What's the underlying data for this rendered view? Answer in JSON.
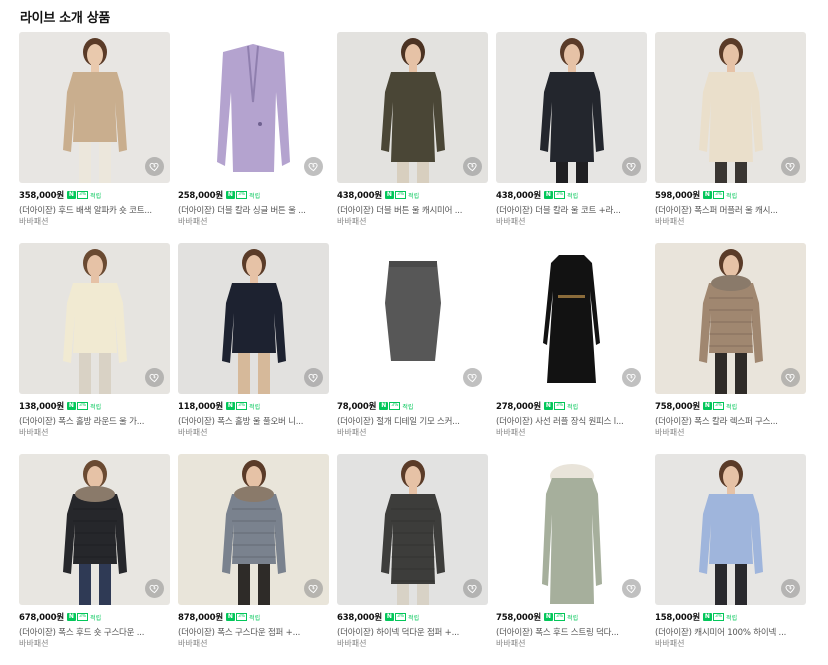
{
  "section_title": "라이브 소개 상품",
  "products": [
    {
      "price": "358,000원",
      "name": "(더아이잗) 후드 배색 알파카 숏 코트...",
      "seller": "바바패션",
      "bg": "#e8e6e3",
      "coat": "#c9ae8e",
      "skin": "#e9c9ad",
      "hair": "#5a3b28",
      "pants": "#ece7dc",
      "style": "short"
    },
    {
      "price": "258,000원",
      "name": "(더아이잗) 더블 칼라 싱글 버튼 울 ...",
      "seller": "바바패션",
      "bg": "#ffffff",
      "coat": "#b4a3cf",
      "skin": "#ffffff",
      "hair": "#ffffff",
      "pants": "#ffffff",
      "style": "flat"
    },
    {
      "price": "438,000원",
      "name": "(더아이잗) 더블 버튼 울 캐시미어 ...",
      "seller": "바바패션",
      "bg": "#e3e2df",
      "coat": "#4a4636",
      "skin": "#e6c2a6",
      "hair": "#4b3222",
      "pants": "#d8cfbf",
      "style": "long"
    },
    {
      "price": "438,000원",
      "name": "(더아이잗) 더블 칼라 울 코트 +라...",
      "seller": "바바패션",
      "bg": "#e6e5e3",
      "coat": "#23262d",
      "skin": "#e6c2a6",
      "hair": "#5a3b28",
      "pants": "#1f1f22",
      "style": "long"
    },
    {
      "price": "598,000원",
      "name": "(더아이잗) 폭스퍼 머플러 울 캐시...",
      "seller": "바바패션",
      "bg": "#e7e5e1",
      "coat": "#eadfcb",
      "skin": "#e6c2a6",
      "hair": "#5a3b28",
      "pants": "#3a3632",
      "style": "long"
    },
    {
      "price": "138,000원",
      "name": "(더아이잗) 폭스 홀방 라운드 울 가...",
      "seller": "바바패션",
      "bg": "#e6e4e0",
      "coat": "#f1ead2",
      "skin": "#e6c2a6",
      "hair": "#6a4a32",
      "pants": "#d9d2c5",
      "style": "short"
    },
    {
      "price": "118,000원",
      "name": "(더아이잗) 폭스 홀방 울 풀오버 니...",
      "seller": "바바패션",
      "bg": "#e2e1df",
      "coat": "#1d2230",
      "skin": "#e6c2a6",
      "hair": "#5a3b28",
      "pants": "#d6b99a",
      "style": "short"
    },
    {
      "price": "78,000원",
      "name": "(더아이잗) 절개 디테일 기모 스커...",
      "seller": "바바패션",
      "bg": "#ffffff",
      "coat": "#575757",
      "skin": "#ffffff",
      "hair": "#ffffff",
      "pants": "#ffffff",
      "style": "skirt"
    },
    {
      "price": "278,000원",
      "name": "(더아이잗) 사선 러플 장식 원피스 l...",
      "seller": "바바패션",
      "bg": "#ffffff",
      "coat": "#121212",
      "skin": "#ffffff",
      "hair": "#ffffff",
      "pants": "#ffffff",
      "style": "dress"
    },
    {
      "price": "758,000원",
      "name": "(더아이잗) 폭스 칼라 렉스퍼 구스...",
      "seller": "바바패션",
      "bg": "#e9e4db",
      "coat": "#a08770",
      "skin": "#e6c2a6",
      "hair": "#5a3b28",
      "pants": "#2f2b28",
      "style": "puffer"
    },
    {
      "price": "678,000원",
      "name": "(더아이잗) 폭스 후드 숏 구스다운 ...",
      "seller": "바바패션",
      "bg": "#e8e6e1",
      "coat": "#26272b",
      "skin": "#e6c2a6",
      "hair": "#6a4a32",
      "pants": "#2f3a55",
      "style": "puffer"
    },
    {
      "price": "878,000원",
      "name": "(더아이잗) 폭스 구스다운 점퍼 +...",
      "seller": "바바패션",
      "bg": "#e9e5da",
      "coat": "#7a828e",
      "skin": "#e6c2a6",
      "hair": "#5a3b28",
      "pants": "#2e2b28",
      "style": "puffer"
    },
    {
      "price": "638,000원",
      "name": "(더아이잗) 하이넥 덕다운 점퍼 +...",
      "seller": "바바패션",
      "bg": "#e2e2e1",
      "coat": "#3d3d3b",
      "skin": "#e6c2a6",
      "hair": "#5a3b28",
      "pants": "#d8d2c6",
      "style": "longpuffer"
    },
    {
      "price": "758,000원",
      "name": "(더아이잗) 폭스 후드 스트링 덕다...",
      "seller": "바바패션",
      "bg": "#ffffff",
      "coat": "#a6af9c",
      "skin": "#ffffff",
      "hair": "#ffffff",
      "pants": "#ffffff",
      "style": "parka"
    },
    {
      "price": "158,000원",
      "name": "(더아이잗) 캐시미어 100% 하이넥 ...",
      "seller": "바바패션",
      "bg": "#e6e5e3",
      "coat": "#9fb5dc",
      "skin": "#e6c2a6",
      "hair": "#5a3b28",
      "pants": "#2a2a2e",
      "style": "short"
    }
  ],
  "npay_badge": {
    "n": "N",
    "pct": "3%",
    "label": "적립"
  },
  "colors": {
    "accent_green": "#03c75a",
    "heart_bg": "#8c8c8c"
  },
  "icons": {
    "wishlist": "heart-icon"
  }
}
